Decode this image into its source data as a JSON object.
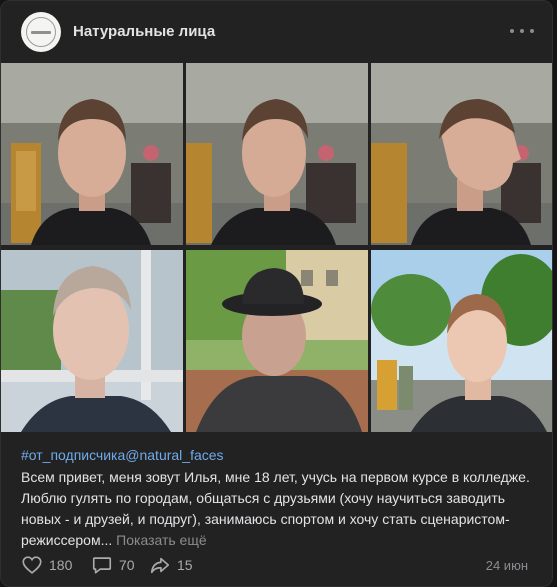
{
  "post": {
    "author": "Натуральные лица",
    "hashtag": "#от_подписчика@natural_faces",
    "text": "Всем привет, меня зовут Илья, мне 18 лет, учусь на первом курсе в колледже. Люблю гулять по городам, общаться с друзьями (хочу научиться заводить новых - и друзей, и подруг), занимаюсь спортом и хочу стать сценаристом-режиссером...",
    "show_more": "Показать ещё",
    "date": "24 июн"
  },
  "actions": {
    "likes": "180",
    "comments": "70",
    "shares": "15"
  },
  "icons": {
    "avatar": "community-logo",
    "more": "more-horizontal-icon",
    "like": "heart-icon",
    "comment": "comment-icon",
    "share": "share-icon"
  },
  "colors": {
    "background": "#222222",
    "link": "#71aaeb",
    "muted": "#8a8c90",
    "text": "#e1e3e6"
  }
}
